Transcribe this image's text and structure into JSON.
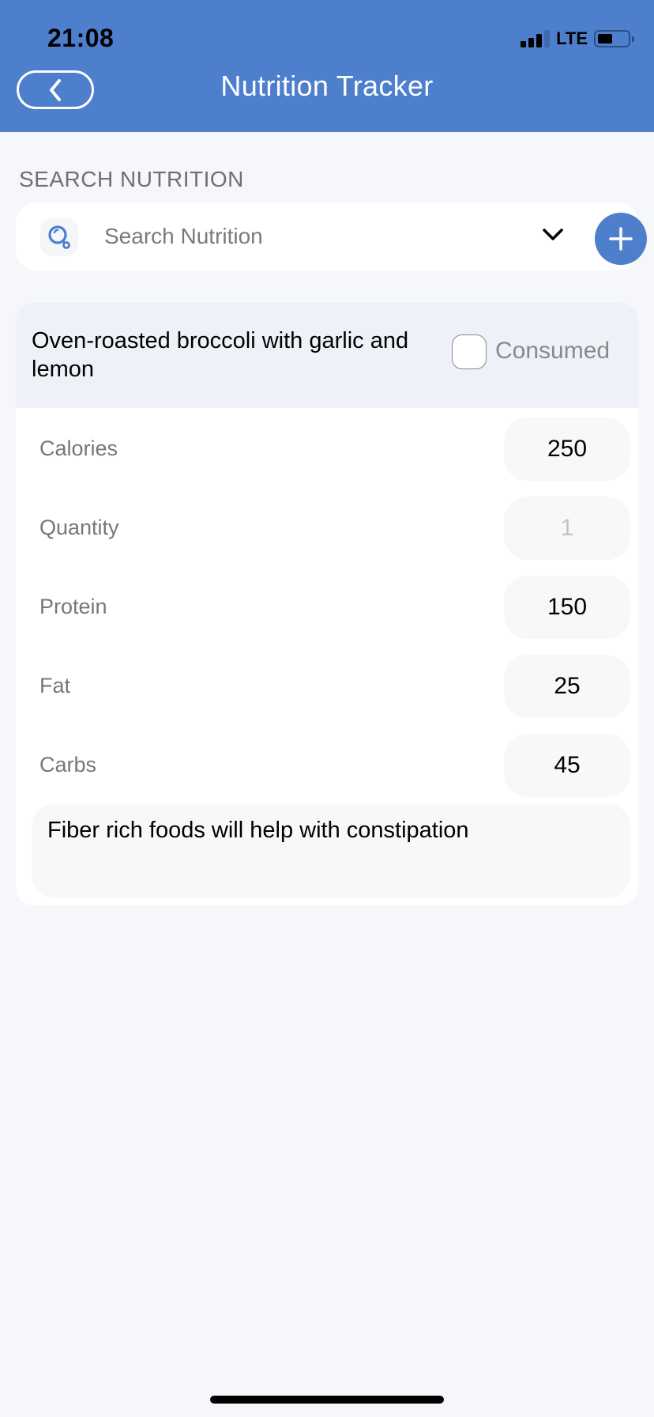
{
  "status_bar": {
    "time": "21:08",
    "network": "LTE",
    "signal_bars": 3,
    "signal_bars_total": 4,
    "battery_level": 0.4
  },
  "header": {
    "title": "Nutrition Tracker",
    "back_icon": "chevron-left-icon"
  },
  "search": {
    "section_label": "SEARCH NUTRITION",
    "placeholder": "Search Nutrition",
    "value": "",
    "search_icon": "magnifier-icon",
    "dropdown_icon": "chevron-down-icon",
    "add_icon": "plus-icon"
  },
  "entry": {
    "title": "Oven-roasted broccoli with garlic and lemon",
    "consumed_label": "Consumed",
    "consumed": false,
    "fields": [
      {
        "label": "Calories",
        "value": "250",
        "muted": false
      },
      {
        "label": "Quantity",
        "value": "1",
        "muted": true
      },
      {
        "label": "Protein",
        "value": "150",
        "muted": false
      },
      {
        "label": "Fat",
        "value": "25",
        "muted": false
      },
      {
        "label": "Carbs",
        "value": "45",
        "muted": false
      }
    ],
    "notes": "Fiber rich foods will help with constipation"
  },
  "colors": {
    "primary": "#4d7fcd",
    "background": "#f6f7fb",
    "card_header": "#eef1f8"
  }
}
